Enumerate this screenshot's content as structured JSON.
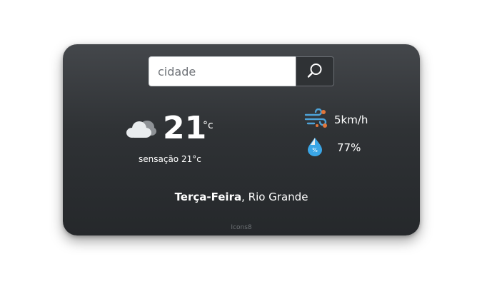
{
  "search": {
    "placeholder": "cidade",
    "button_icon": "search-icon"
  },
  "weather": {
    "condition_icon": "cloud-icon",
    "temperature": "21",
    "unit": "°c",
    "feels_like": "sensação 21°c"
  },
  "wind": {
    "icon": "wind-icon",
    "value": "5km/h"
  },
  "humidity": {
    "icon": "humidity-drop-icon",
    "value": "77%",
    "icon_label": "%"
  },
  "location": {
    "day": "Terça-Feira",
    "separator": ",",
    "city": " Rio Grande"
  },
  "credit": "Icons8",
  "colors": {
    "card_top": "#44474b",
    "card_bottom": "#25282b",
    "drop_blue": "#3aa6e6",
    "wind_blue": "#4ea3d9",
    "wind_orange": "#e2763a"
  }
}
